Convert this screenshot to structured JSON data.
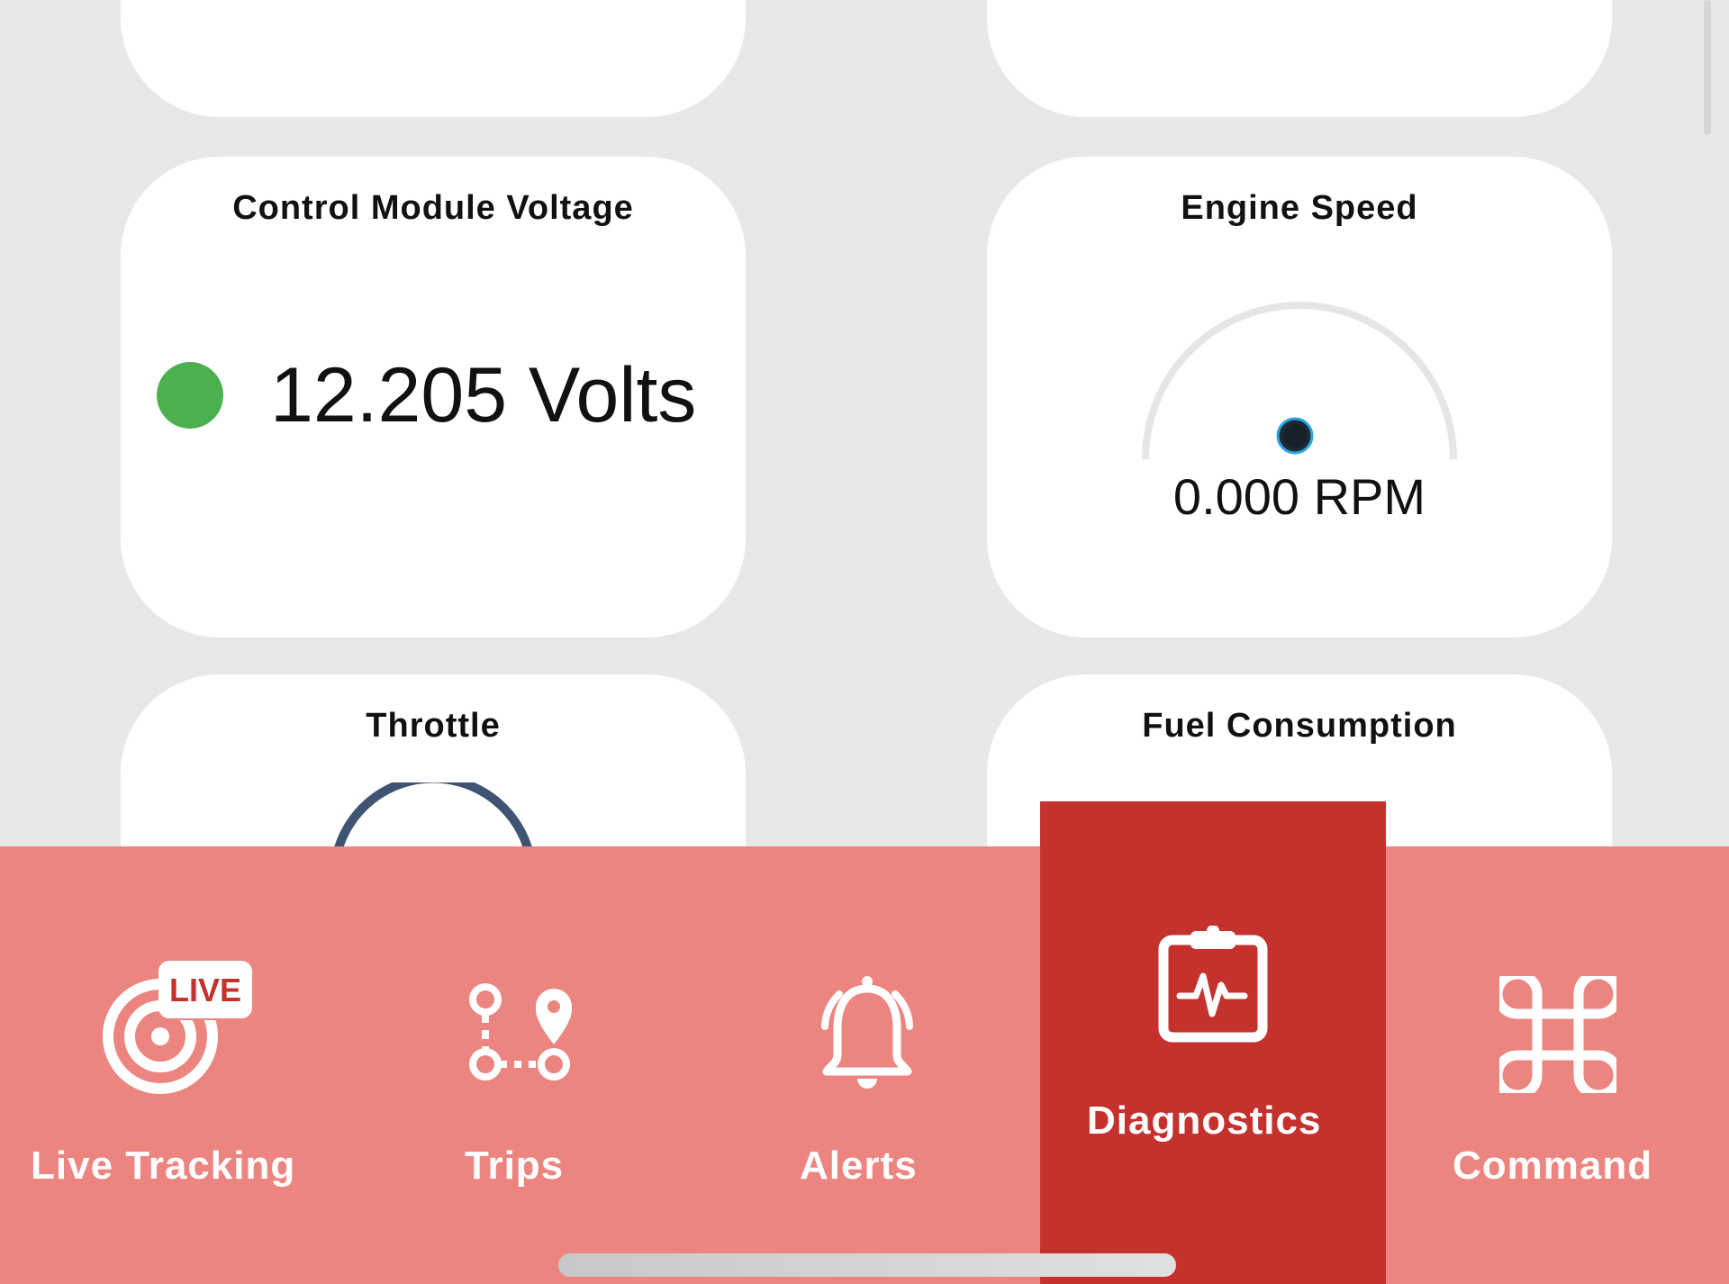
{
  "cards": {
    "voltage": {
      "title": "Control Module Voltage",
      "value": "12.205 Volts",
      "status_color": "#4caf50"
    },
    "engine_speed": {
      "title": "Engine Speed",
      "value": "0.000 RPM",
      "gauge_level": 0
    },
    "throttle": {
      "title": "Throttle"
    },
    "fuel": {
      "title": "Fuel Consumption"
    }
  },
  "tabbar": {
    "color": "#ec8580",
    "active_color": "#c5322e",
    "tabs": [
      {
        "label": "Live Tracking",
        "icon": "live-tracking-icon",
        "badge": "LIVE",
        "active": false
      },
      {
        "label": "Trips",
        "icon": "route-icon",
        "active": false
      },
      {
        "label": "Alerts",
        "icon": "bell-icon",
        "active": false
      },
      {
        "label": "Diagnostics",
        "icon": "clipboard-pulse-icon",
        "active": true
      },
      {
        "label": "Command",
        "icon": "command-icon",
        "active": false
      }
    ]
  }
}
